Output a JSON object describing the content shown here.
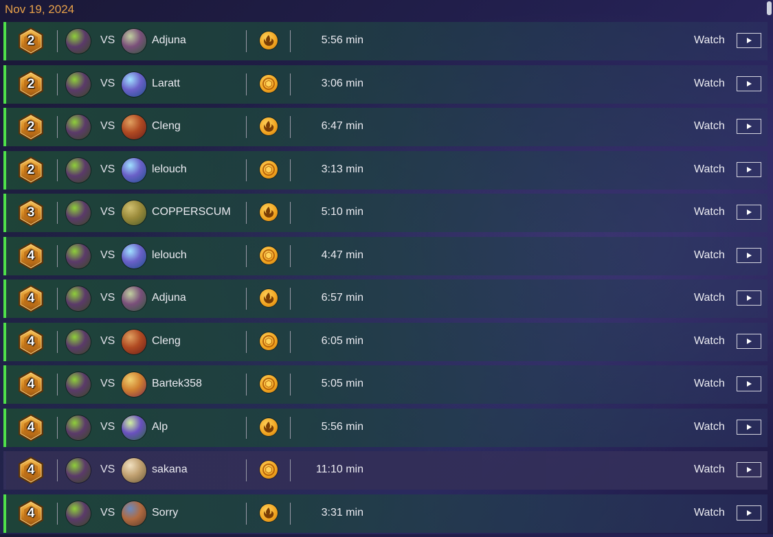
{
  "header": {
    "date": "Nov 19, 2024"
  },
  "colors": {
    "win_accent": "#4fe04a",
    "date_text": "#e9a24a",
    "coin": "#f0a21e"
  },
  "me": {
    "avatar_colors": [
      "#3b4a25",
      "#5b3a6a",
      "#8fcf3a"
    ]
  },
  "vs_label": "VS",
  "watch_label": "Watch",
  "matches": [
    {
      "rank": "2",
      "opponent": "Adjuna",
      "opp_colors": [
        "#2e5a3a",
        "#7a4f7a",
        "#c0d0a0"
      ],
      "mode_icon": "fire-icon",
      "duration": "5:56 min",
      "result": "win"
    },
    {
      "rank": "2",
      "opponent": "Laratt",
      "opp_colors": [
        "#1e4f8a",
        "#6a60c8",
        "#a0e0ff"
      ],
      "mode_icon": "coin-icon",
      "duration": "3:06 min",
      "result": "win"
    },
    {
      "rank": "2",
      "opponent": "Cleng",
      "opp_colors": [
        "#6a1f1a",
        "#b04a22",
        "#e0a060"
      ],
      "mode_icon": "fire-icon",
      "duration": "6:47 min",
      "result": "win"
    },
    {
      "rank": "2",
      "opponent": "lelouch",
      "opp_colors": [
        "#1e4f8a",
        "#6a60c8",
        "#a0e0ff"
      ],
      "mode_icon": "coin-icon",
      "duration": "3:13 min",
      "result": "win"
    },
    {
      "rank": "3",
      "opponent": "COPPERSCUM",
      "opp_colors": [
        "#4a5a2a",
        "#9a8a3a",
        "#d0c070"
      ],
      "mode_icon": "fire-icon",
      "duration": "5:10 min",
      "result": "win"
    },
    {
      "rank": "4",
      "opponent": "lelouch",
      "opp_colors": [
        "#1e4f8a",
        "#6a60c8",
        "#a0e0ff"
      ],
      "mode_icon": "coin-icon",
      "duration": "4:47 min",
      "result": "win"
    },
    {
      "rank": "4",
      "opponent": "Adjuna",
      "opp_colors": [
        "#2e5a3a",
        "#7a4f7a",
        "#c0d0a0"
      ],
      "mode_icon": "fire-icon",
      "duration": "6:57 min",
      "result": "win"
    },
    {
      "rank": "4",
      "opponent": "Cleng",
      "opp_colors": [
        "#6a1f1a",
        "#b04a22",
        "#e0a060"
      ],
      "mode_icon": "coin-icon",
      "duration": "6:05 min",
      "result": "win"
    },
    {
      "rank": "4",
      "opponent": "Bartek358",
      "opp_colors": [
        "#7a2a4a",
        "#d08030",
        "#f0d070"
      ],
      "mode_icon": "coin-icon",
      "duration": "5:05 min",
      "result": "win"
    },
    {
      "rank": "4",
      "opponent": "Alp",
      "opp_colors": [
        "#2a6a3a",
        "#6a50c0",
        "#d0f0a0"
      ],
      "mode_icon": "fire-icon",
      "duration": "5:56 min",
      "result": "win"
    },
    {
      "rank": "4",
      "opponent": "sakana",
      "opp_colors": [
        "#6a5a3a",
        "#c0a070",
        "#f0e0c0"
      ],
      "mode_icon": "coin-icon",
      "duration": "11:10 min",
      "result": "loss"
    },
    {
      "rank": "4",
      "opponent": "Sorry",
      "opp_colors": [
        "#5a3a2a",
        "#b06a40",
        "#6a8ac0"
      ],
      "mode_icon": "fire-icon",
      "duration": "3:31 min",
      "result": "win"
    }
  ]
}
